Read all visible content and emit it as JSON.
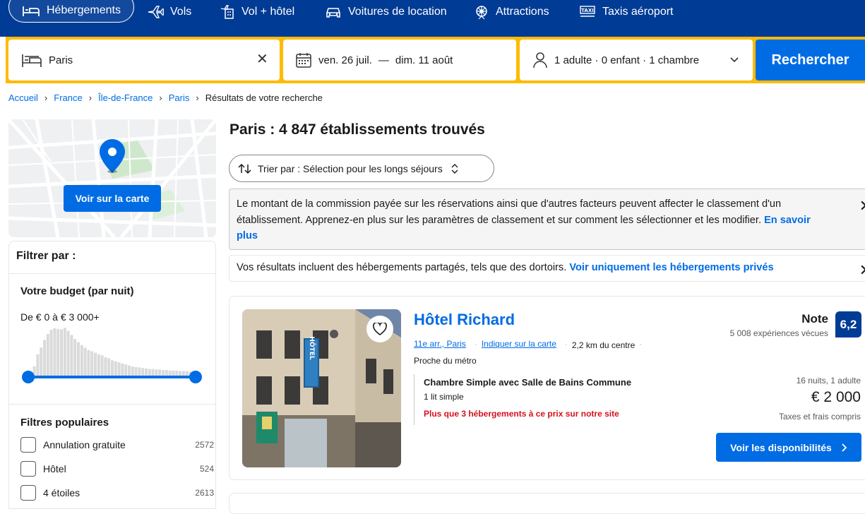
{
  "nav": {
    "items": [
      {
        "label": "Hébergements",
        "icon": "bed-icon"
      },
      {
        "label": "Vols",
        "icon": "plane-icon"
      },
      {
        "label": "Vol + hôtel",
        "icon": "plane-hotel-icon"
      },
      {
        "label": "Voitures de location",
        "icon": "car-icon"
      },
      {
        "label": "Attractions",
        "icon": "attractions-icon"
      },
      {
        "label": "Taxis aéroport",
        "icon": "taxi-icon"
      }
    ]
  },
  "search": {
    "destination": "Paris",
    "checkin": "ven. 26 juil.",
    "dash": "—",
    "checkout": "dim. 11 août",
    "occupancy": "1 adulte · 0 enfant · 1 chambre",
    "button": "Rechercher"
  },
  "breadcrumb": [
    "Accueil",
    "France",
    "Île-de-France",
    "Paris",
    "Résultats de votre recherche"
  ],
  "map": {
    "button": "Voir sur la carte"
  },
  "filters": {
    "header": "Filtrer par :",
    "budget_title": "Votre budget (par nuit)",
    "budget_range": "De € 0 à € 3 000+",
    "histogram": [
      0.05,
      0.08,
      0.18,
      0.42,
      0.55,
      0.7,
      0.82,
      0.9,
      0.93,
      0.92,
      0.91,
      0.94,
      0.88,
      0.8,
      0.72,
      0.66,
      0.6,
      0.55,
      0.5,
      0.48,
      0.45,
      0.42,
      0.4,
      0.36,
      0.34,
      0.3,
      0.28,
      0.26,
      0.24,
      0.22,
      0.2,
      0.18,
      0.17,
      0.16,
      0.15,
      0.14,
      0.13,
      0.13,
      0.12,
      0.12,
      0.11,
      0.11,
      0.1,
      0.1,
      0.1,
      0.09,
      0.09,
      0.09,
      0.08,
      0.08
    ],
    "popular_title": "Filtres populaires",
    "popular": [
      {
        "label": "Annulation gratuite",
        "count": "2572"
      },
      {
        "label": "Hôtel",
        "count": "524"
      },
      {
        "label": "4 étoiles",
        "count": "2613"
      }
    ]
  },
  "results": {
    "title": "Paris : 4 847 établissements trouvés",
    "sort_label": "Trier par : Sélection pour les longs séjours",
    "notice1_text": "Le montant de la commission payée sur les réservations ainsi que d'autres facteurs peuvent affecter le classement d'un établissement. Apprenez-en plus sur les paramètres de classement et sur comment les sélectionner et les modifier.",
    "notice1_link": "En savoir plus",
    "notice2_text": "Vos résultats incluent des hébergements partagés, tels que des dortoirs.",
    "notice2_link": "Voir uniquement les hébergements privés"
  },
  "hotel": {
    "name": "Hôtel Richard",
    "district": "11e arr., Paris",
    "map_link": "Indiquer sur la carte",
    "distance": "2,2 km du centre",
    "metro": "Proche du métro",
    "room_name": "Chambre Simple avec Salle de Bains Commune",
    "bed": "1 lit simple",
    "scarcity": "Plus que 3 hébergements à ce prix sur notre site",
    "score_label": "Note",
    "reviews": "5 008 expériences vécues",
    "score": "6,2",
    "stay": "16 nuits, 1 adulte",
    "price": "€ 2 000",
    "taxes": "Taxes et frais compris",
    "cta": "Voir les disponibilités",
    "sign_text": "HÔTEL"
  },
  "colors": {
    "brand": "#003b95",
    "accent": "#006ce4",
    "search_border": "#febb02",
    "scarcity": "#d4111e"
  }
}
